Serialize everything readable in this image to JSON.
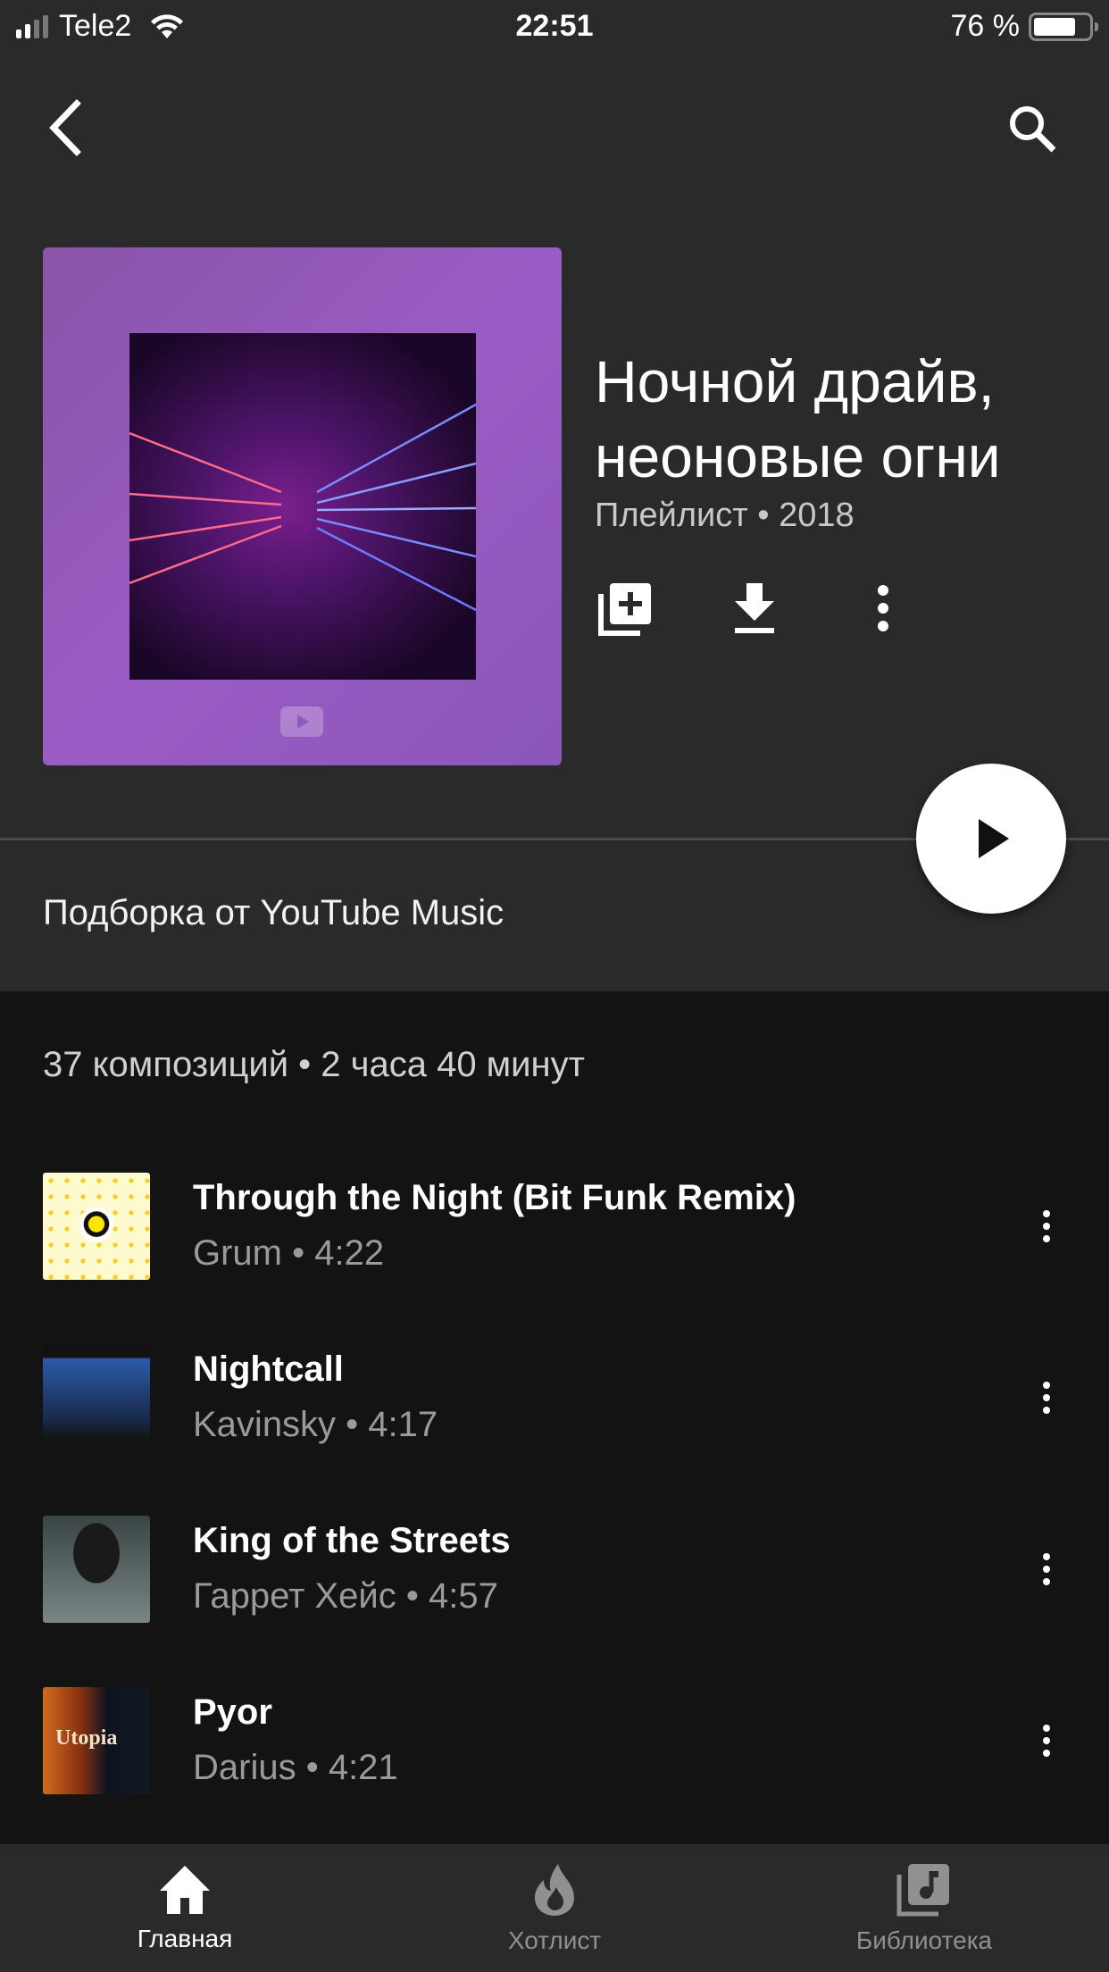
{
  "status_bar": {
    "carrier": "Tele2",
    "time": "22:51",
    "battery_text": "76 %",
    "battery_level": 0.76
  },
  "header": {
    "back_icon": "chevron-left-icon",
    "search_icon": "search-icon"
  },
  "playlist": {
    "title_line1": "Ночной драйв,",
    "title_line2": "неоновые огни",
    "subtitle": "Плейлист • 2018",
    "actions": [
      {
        "name": "add-to-library",
        "icon": "library-add-icon"
      },
      {
        "name": "download",
        "icon": "download-icon"
      },
      {
        "name": "more",
        "icon": "more-vertical-icon"
      }
    ],
    "curator": "Подборка от YouTube Music",
    "summary": "37 композиций • 2 часа 40 минут"
  },
  "tracks": [
    {
      "title": "Through the Night (Bit Funk Remix)",
      "subtitle": "Grum • 4:22"
    },
    {
      "title": "Nightcall",
      "subtitle": "Kavinsky • 4:17"
    },
    {
      "title": "King of the Streets",
      "subtitle": "Гаррет Хейс • 4:57"
    },
    {
      "title": "Pyor",
      "subtitle": "Darius • 4:21",
      "thumb_text": "Utopia"
    }
  ],
  "bottom_nav": {
    "items": [
      {
        "label": "Главная",
        "icon": "home-icon",
        "active": true
      },
      {
        "label": "Хотлист",
        "icon": "flame-icon",
        "active": false
      },
      {
        "label": "Библиотека",
        "icon": "library-music-icon",
        "active": false
      }
    ]
  },
  "colors": {
    "header_bg": "#2a2a2a",
    "list_bg": "#131313",
    "secondary_text": "#9a9a9a",
    "inactive_nav": "#909090"
  }
}
